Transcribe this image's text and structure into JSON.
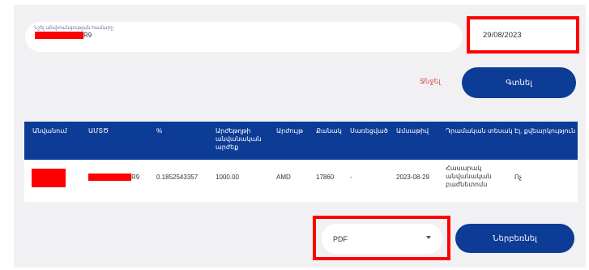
{
  "search": {
    "label": "Նշել անվտանգության համարը",
    "value_suffix": "R9"
  },
  "date": {
    "value": "29/08/2023"
  },
  "actions": {
    "clear_label": "Ջնջել",
    "find_label": "Գտնել"
  },
  "table": {
    "headers": [
      "Անվանում",
      "ԱՄՏԾ",
      "%",
      "Արժեթղթի անվանական արժեք",
      "Արժույթ",
      "Քանակ",
      "Սառեցված",
      "Ամսաթիվ",
      "Դրամական տեսակ",
      "Էլ. քվեարկություն"
    ],
    "row": {
      "amts_suffix": "R9",
      "percent": "0.1852543357",
      "nominal": "1000.00",
      "currency": "AMD",
      "quantity": "17860",
      "frozen": "-",
      "date": "2023-08-29",
      "type": "Հասարակ անվանական բաժնետոմս",
      "e_vote": "Ոչ"
    }
  },
  "export": {
    "format": "PDF",
    "download_label": "Ներբեռնել"
  },
  "colors": {
    "primary": "#0d3c96",
    "highlight": "#ff0000",
    "clear": "#d9534f"
  }
}
